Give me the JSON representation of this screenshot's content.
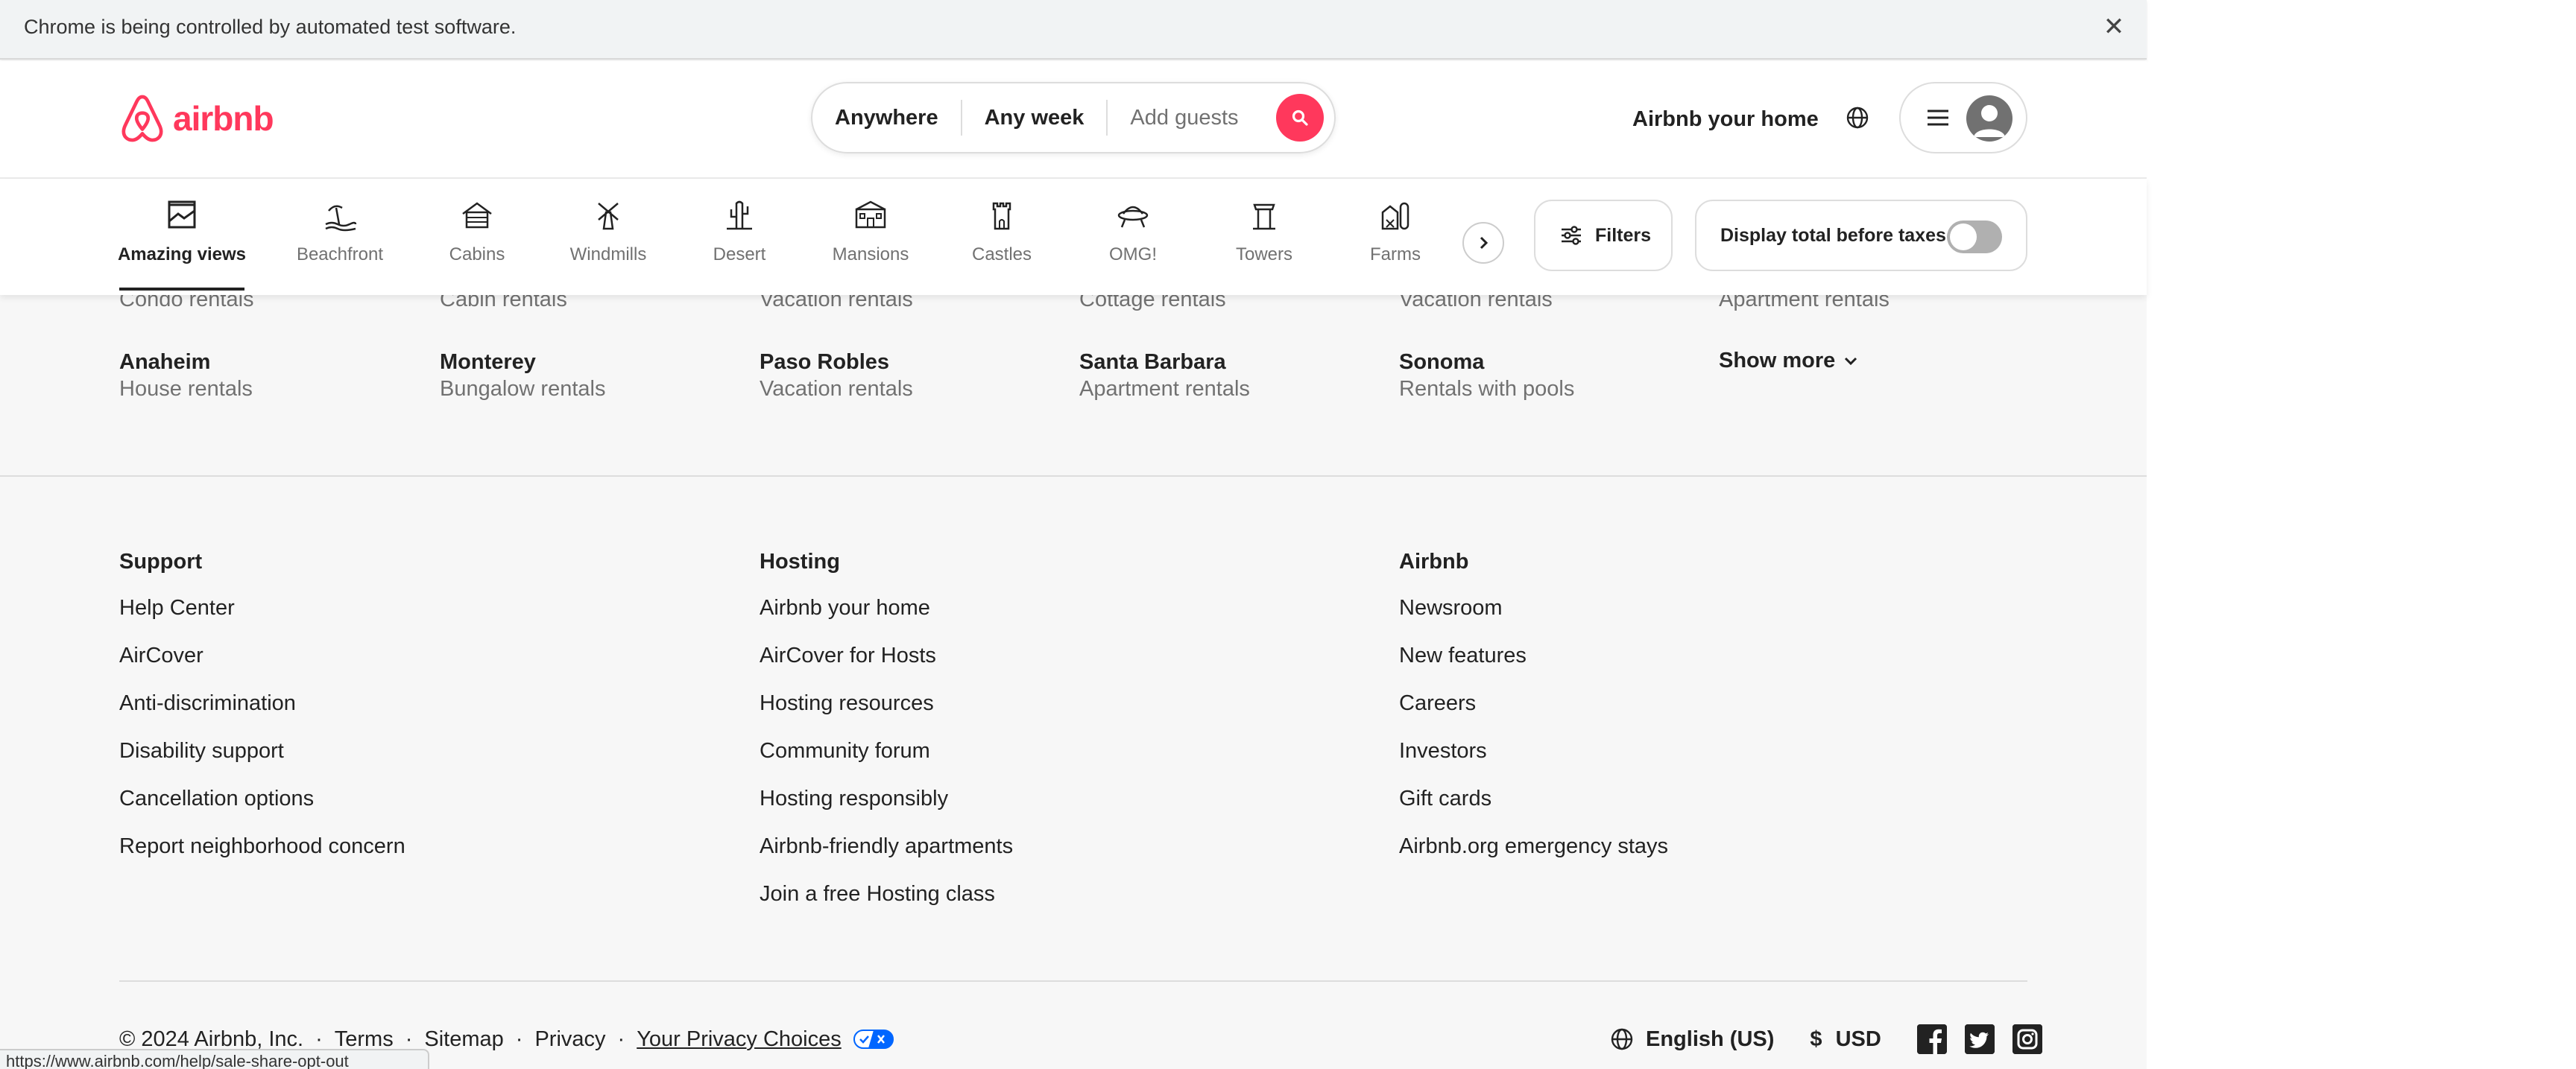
{
  "automation_banner": {
    "text": "Chrome is being controlled by automated test software.",
    "close_icon": "close-icon"
  },
  "header": {
    "logo_text": "airbnb",
    "brand_color": "#ff385c",
    "search": {
      "location": "Anywhere",
      "dates": "Any week",
      "guests_placeholder": "Add guests"
    },
    "host_link": "Airbnb your home"
  },
  "categories": {
    "items": [
      {
        "label": "Amazing views",
        "icon": "amazing-views-icon",
        "active": true
      },
      {
        "label": "Beachfront",
        "icon": "beachfront-icon",
        "active": false
      },
      {
        "label": "Cabins",
        "icon": "cabins-icon",
        "active": false
      },
      {
        "label": "Windmills",
        "icon": "windmills-icon",
        "active": false
      },
      {
        "label": "Desert",
        "icon": "desert-icon",
        "active": false
      },
      {
        "label": "Mansions",
        "icon": "mansions-icon",
        "active": false
      },
      {
        "label": "Castles",
        "icon": "castles-icon",
        "active": false
      },
      {
        "label": "OMG!",
        "icon": "omg-icon",
        "active": false
      },
      {
        "label": "Towers",
        "icon": "towers-icon",
        "active": false
      },
      {
        "label": "Farms",
        "icon": "farms-icon",
        "active": false
      }
    ],
    "filters_label": "Filters",
    "tax_toggle_label": "Display total before taxes",
    "tax_toggle_on": false
  },
  "destinations": {
    "partial_row": [
      {
        "type": "Condo rentals"
      },
      {
        "type": "Cabin rentals"
      },
      {
        "type": "Vacation rentals"
      },
      {
        "type": "Cottage rentals"
      },
      {
        "type": "Vacation rentals"
      },
      {
        "type": "Apartment rentals"
      }
    ],
    "row": [
      {
        "city": "Anaheim",
        "type": "House rentals"
      },
      {
        "city": "Monterey",
        "type": "Bungalow rentals"
      },
      {
        "city": "Paso Robles",
        "type": "Vacation rentals"
      },
      {
        "city": "Santa Barbara",
        "type": "Apartment rentals"
      },
      {
        "city": "Sonoma",
        "type": "Rentals with pools"
      }
    ],
    "show_more": "Show more"
  },
  "footer": {
    "columns": [
      {
        "heading": "Support",
        "links": [
          "Help Center",
          "AirCover",
          "Anti-discrimination",
          "Disability support",
          "Cancellation options",
          "Report neighborhood concern"
        ]
      },
      {
        "heading": "Hosting",
        "links": [
          "Airbnb your home",
          "AirCover for Hosts",
          "Hosting resources",
          "Community forum",
          "Hosting responsibly",
          "Airbnb-friendly apartments",
          "Join a free Hosting class"
        ]
      },
      {
        "heading": "Airbnb",
        "links": [
          "Newsroom",
          "New features",
          "Careers",
          "Investors",
          "Gift cards",
          "Airbnb.org emergency stays"
        ]
      }
    ],
    "copyright": "© 2024 Airbnb, Inc.",
    "legal_links": [
      "Terms",
      "Sitemap",
      "Privacy",
      "Your Privacy Choices"
    ],
    "language": "English (US)",
    "currency_symbol": "$",
    "currency": "USD",
    "social": [
      "facebook-icon",
      "twitter-icon",
      "instagram-icon"
    ]
  },
  "status_bar": {
    "url": "https://www.airbnb.com/help/sale-share-opt-out"
  }
}
